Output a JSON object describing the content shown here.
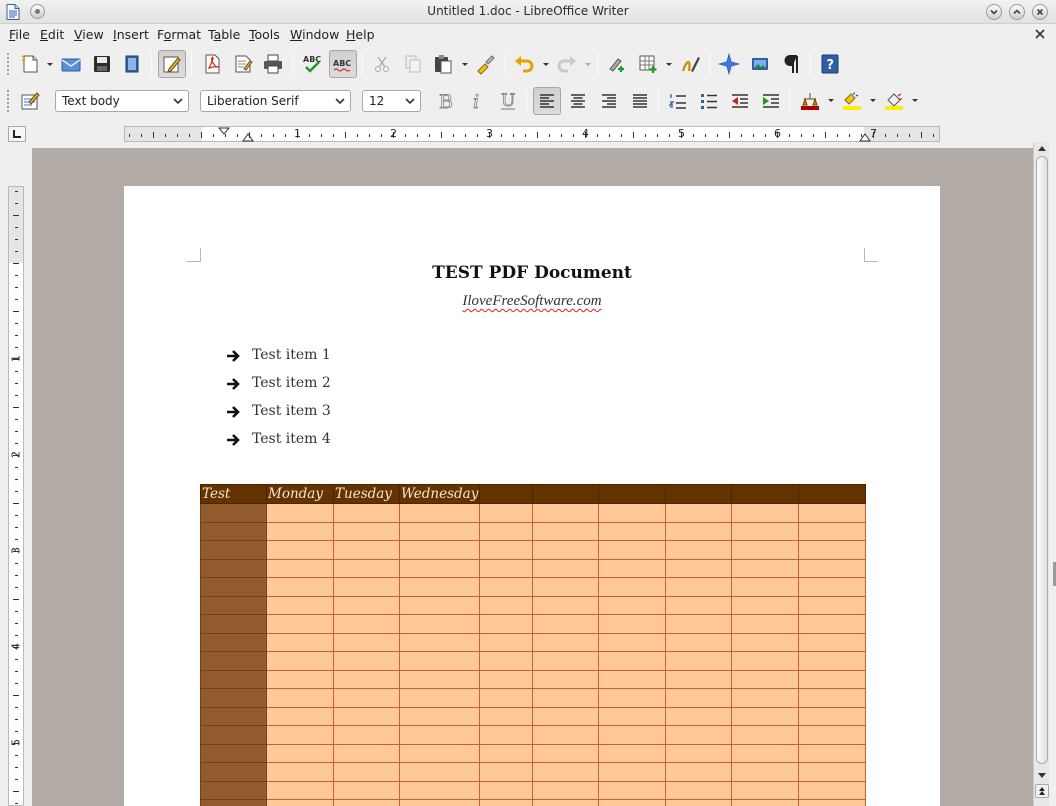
{
  "window": {
    "title": "Untitled 1.doc - LibreOffice Writer"
  },
  "menu": {
    "items": [
      {
        "label": "File",
        "accel": "F",
        "rest": "ile"
      },
      {
        "label": "Edit",
        "accel": "E",
        "rest": "dit"
      },
      {
        "label": "View",
        "accel": "V",
        "rest": "iew"
      },
      {
        "label": "Insert",
        "accel": "I",
        "rest": "nsert"
      },
      {
        "label": "Format",
        "accel": "o",
        "pre": "F",
        "rest": "rmat"
      },
      {
        "label": "Table",
        "accel": "a",
        "pre": "T",
        "rest": "ble"
      },
      {
        "label": "Tools",
        "accel": "T",
        "rest": "ools"
      },
      {
        "label": "Window",
        "accel": "W",
        "rest": "indow"
      },
      {
        "label": "Help",
        "accel": "H",
        "rest": "elp"
      }
    ]
  },
  "formatting": {
    "paragraph_style": "Text body",
    "font_name": "Liberation Serif",
    "font_size": "12"
  },
  "ruler": {
    "h_numbers": [
      "1",
      "2",
      "3",
      "4",
      "5",
      "6",
      "7"
    ],
    "v_numbers": [
      "1",
      "2",
      "3",
      "4",
      "5"
    ]
  },
  "document": {
    "title": "TEST PDF Document",
    "subtitle": "IloveFreeSoftware.com",
    "list_items": [
      "Test item 1",
      "Test item 2",
      "Test item 3",
      "Test item 4"
    ],
    "table": {
      "headers": [
        "Test",
        "Monday",
        "Tuesday",
        "Wednesday",
        "",
        "",
        "",
        "",
        "",
        ""
      ],
      "visible_body_rows": 17
    }
  },
  "colors": {
    "table_header_bg": "#653300",
    "table_first_col_bg": "#935b2e",
    "table_cell_bg": "#fec997",
    "table_border": "#c8612e",
    "doc_background": "#b1aaa5"
  }
}
